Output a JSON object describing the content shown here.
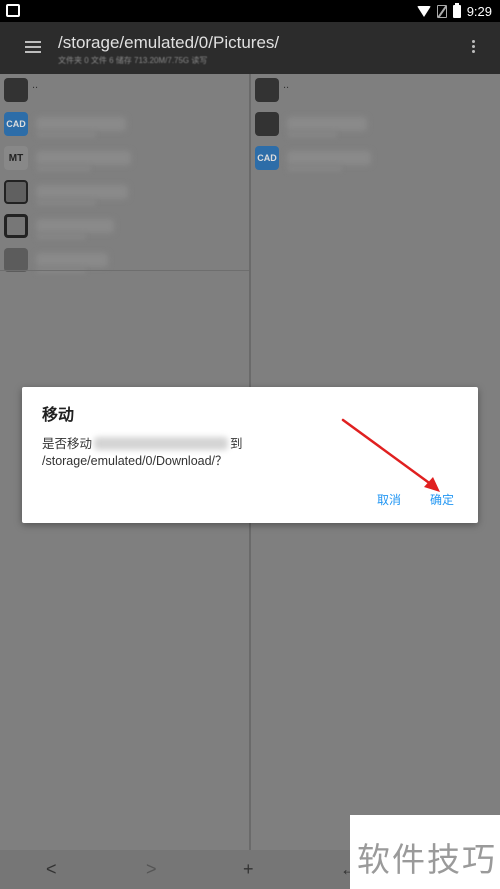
{
  "statusbar": {
    "time": "9:29"
  },
  "toolbar": {
    "title": "/storage/emulated/0/Pictures/",
    "subtitle": "文件夹 0 文件 6 储存 713.20M/7.75G 读写"
  },
  "left_pane": {
    "items": [
      {
        "icon": "folder-icon",
        "label": ".."
      },
      {
        "icon": "cad-file-icon",
        "label": "CAD"
      },
      {
        "icon": "mt-app-icon",
        "label": "MT"
      },
      {
        "icon": "document-icon",
        "label": ""
      },
      {
        "icon": "chip-icon",
        "label": ""
      },
      {
        "icon": "document-icon",
        "label": ""
      }
    ]
  },
  "right_pane": {
    "items": [
      {
        "icon": "folder-icon",
        "label": ".."
      },
      {
        "icon": "folder-icon",
        "label": ""
      },
      {
        "icon": "cad-file-icon",
        "label": "CAD"
      }
    ]
  },
  "dialog": {
    "title": "移动",
    "message_prefix": "是否移动",
    "message_suffix": "到",
    "message_path": "/storage/emulated/0/Download/？",
    "cancel_label": "取消",
    "ok_label": "确定"
  },
  "bottombar": {
    "back": "<",
    "forward": ">",
    "add": "+",
    "more": "←"
  },
  "watermark": {
    "text": "软件技巧"
  },
  "colors": {
    "accent": "#2196f3",
    "annotation": "#e02020",
    "toolbar": "#2c2c2c"
  }
}
